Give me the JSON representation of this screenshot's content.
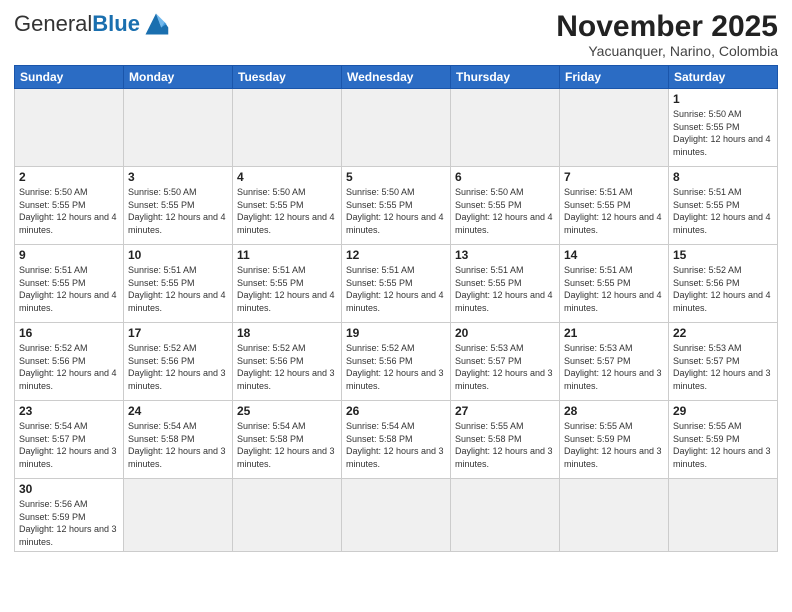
{
  "header": {
    "logo_general": "General",
    "logo_blue": "Blue",
    "month_title": "November 2025",
    "subtitle": "Yacuanquer, Narino, Colombia"
  },
  "weekdays": [
    "Sunday",
    "Monday",
    "Tuesday",
    "Wednesday",
    "Thursday",
    "Friday",
    "Saturday"
  ],
  "days": {
    "d1": {
      "num": "1",
      "info": "Sunrise: 5:50 AM\nSunset: 5:55 PM\nDaylight: 12 hours and 4 minutes."
    },
    "d2": {
      "num": "2",
      "info": "Sunrise: 5:50 AM\nSunset: 5:55 PM\nDaylight: 12 hours and 4 minutes."
    },
    "d3": {
      "num": "3",
      "info": "Sunrise: 5:50 AM\nSunset: 5:55 PM\nDaylight: 12 hours and 4 minutes."
    },
    "d4": {
      "num": "4",
      "info": "Sunrise: 5:50 AM\nSunset: 5:55 PM\nDaylight: 12 hours and 4 minutes."
    },
    "d5": {
      "num": "5",
      "info": "Sunrise: 5:50 AM\nSunset: 5:55 PM\nDaylight: 12 hours and 4 minutes."
    },
    "d6": {
      "num": "6",
      "info": "Sunrise: 5:50 AM\nSunset: 5:55 PM\nDaylight: 12 hours and 4 minutes."
    },
    "d7": {
      "num": "7",
      "info": "Sunrise: 5:51 AM\nSunset: 5:55 PM\nDaylight: 12 hours and 4 minutes."
    },
    "d8": {
      "num": "8",
      "info": "Sunrise: 5:51 AM\nSunset: 5:55 PM\nDaylight: 12 hours and 4 minutes."
    },
    "d9": {
      "num": "9",
      "info": "Sunrise: 5:51 AM\nSunset: 5:55 PM\nDaylight: 12 hours and 4 minutes."
    },
    "d10": {
      "num": "10",
      "info": "Sunrise: 5:51 AM\nSunset: 5:55 PM\nDaylight: 12 hours and 4 minutes."
    },
    "d11": {
      "num": "11",
      "info": "Sunrise: 5:51 AM\nSunset: 5:55 PM\nDaylight: 12 hours and 4 minutes."
    },
    "d12": {
      "num": "12",
      "info": "Sunrise: 5:51 AM\nSunset: 5:55 PM\nDaylight: 12 hours and 4 minutes."
    },
    "d13": {
      "num": "13",
      "info": "Sunrise: 5:51 AM\nSunset: 5:55 PM\nDaylight: 12 hours and 4 minutes."
    },
    "d14": {
      "num": "14",
      "info": "Sunrise: 5:51 AM\nSunset: 5:55 PM\nDaylight: 12 hours and 4 minutes."
    },
    "d15": {
      "num": "15",
      "info": "Sunrise: 5:52 AM\nSunset: 5:56 PM\nDaylight: 12 hours and 4 minutes."
    },
    "d16": {
      "num": "16",
      "info": "Sunrise: 5:52 AM\nSunset: 5:56 PM\nDaylight: 12 hours and 4 minutes."
    },
    "d17": {
      "num": "17",
      "info": "Sunrise: 5:52 AM\nSunset: 5:56 PM\nDaylight: 12 hours and 3 minutes."
    },
    "d18": {
      "num": "18",
      "info": "Sunrise: 5:52 AM\nSunset: 5:56 PM\nDaylight: 12 hours and 3 minutes."
    },
    "d19": {
      "num": "19",
      "info": "Sunrise: 5:52 AM\nSunset: 5:56 PM\nDaylight: 12 hours and 3 minutes."
    },
    "d20": {
      "num": "20",
      "info": "Sunrise: 5:53 AM\nSunset: 5:57 PM\nDaylight: 12 hours and 3 minutes."
    },
    "d21": {
      "num": "21",
      "info": "Sunrise: 5:53 AM\nSunset: 5:57 PM\nDaylight: 12 hours and 3 minutes."
    },
    "d22": {
      "num": "22",
      "info": "Sunrise: 5:53 AM\nSunset: 5:57 PM\nDaylight: 12 hours and 3 minutes."
    },
    "d23": {
      "num": "23",
      "info": "Sunrise: 5:54 AM\nSunset: 5:57 PM\nDaylight: 12 hours and 3 minutes."
    },
    "d24": {
      "num": "24",
      "info": "Sunrise: 5:54 AM\nSunset: 5:58 PM\nDaylight: 12 hours and 3 minutes."
    },
    "d25": {
      "num": "25",
      "info": "Sunrise: 5:54 AM\nSunset: 5:58 PM\nDaylight: 12 hours and 3 minutes."
    },
    "d26": {
      "num": "26",
      "info": "Sunrise: 5:54 AM\nSunset: 5:58 PM\nDaylight: 12 hours and 3 minutes."
    },
    "d27": {
      "num": "27",
      "info": "Sunrise: 5:55 AM\nSunset: 5:58 PM\nDaylight: 12 hours and 3 minutes."
    },
    "d28": {
      "num": "28",
      "info": "Sunrise: 5:55 AM\nSunset: 5:59 PM\nDaylight: 12 hours and 3 minutes."
    },
    "d29": {
      "num": "29",
      "info": "Sunrise: 5:55 AM\nSunset: 5:59 PM\nDaylight: 12 hours and 3 minutes."
    },
    "d30": {
      "num": "30",
      "info": "Sunrise: 5:56 AM\nSunset: 5:59 PM\nDaylight: 12 hours and 3 minutes."
    }
  }
}
